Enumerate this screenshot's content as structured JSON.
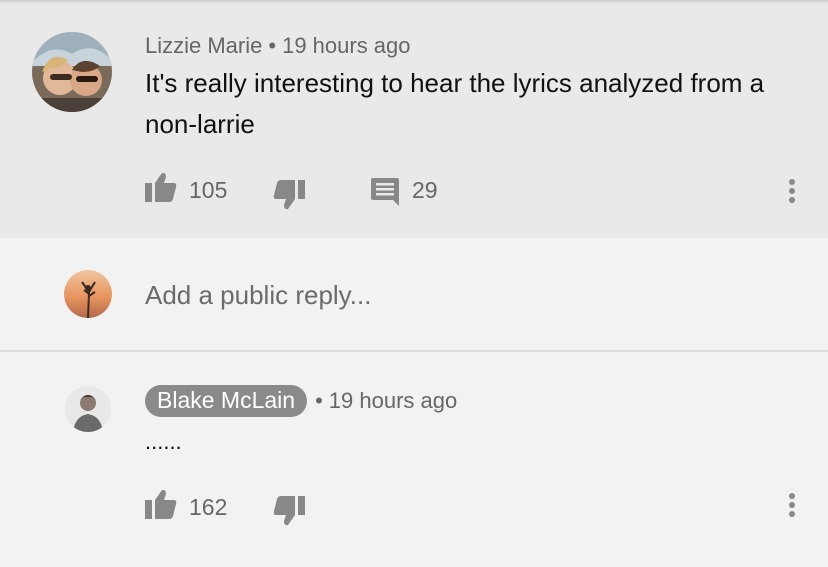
{
  "comment": {
    "author": "Lizzie Marie",
    "time": "19 hours ago",
    "text": "It's really interesting to hear the lyrics analyzed from a non-larrie",
    "likes": "105",
    "replies": "29"
  },
  "reply_input": {
    "placeholder": "Add a public reply..."
  },
  "reply": {
    "author": "Blake McLain",
    "time": "19 hours ago",
    "text": "......",
    "likes": "162"
  },
  "icons": [
    "thumbs-up-icon",
    "thumbs-down-icon",
    "comment-icon",
    "more-vert-icon"
  ],
  "colors": {
    "top_bg": "#e9e9e9",
    "body_bg": "#f2f2f2",
    "icon_gray": "#888888",
    "chip_bg": "#8a8a8a"
  }
}
